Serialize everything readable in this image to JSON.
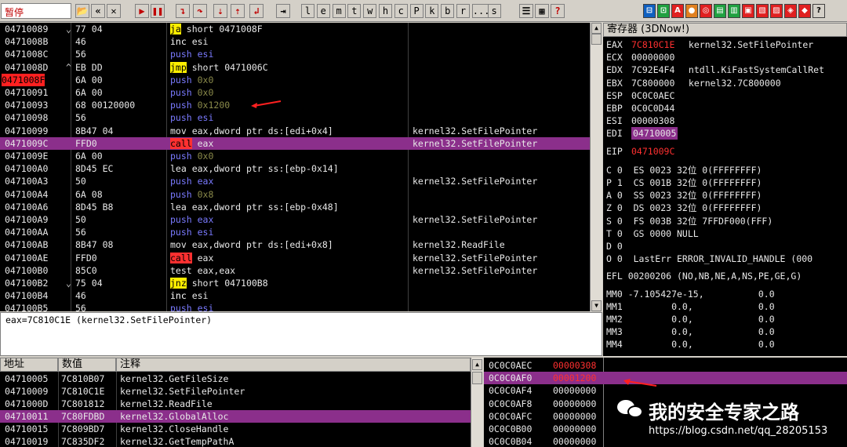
{
  "toolbar": {
    "status": "暂停",
    "letters": [
      "l",
      "e",
      "m",
      "t",
      "w",
      "h",
      "c",
      "P",
      "k",
      "b",
      "r",
      "...",
      "s"
    ]
  },
  "disasm": [
    {
      "a": "04710089",
      "caret": "⌄",
      "h": "77 04",
      "op": "ja",
      "ok": "jcc",
      "arg": " short 0471008F",
      "c": ""
    },
    {
      "a": "0471008B",
      "caret": "",
      "h": "46",
      "op": "inc",
      "ok": "inc",
      "arg": " esi",
      "c": ""
    },
    {
      "a": "0471008C",
      "caret": "",
      "h": "56",
      "op": "push",
      "ok": "push",
      "arg": " esi",
      "c": ""
    },
    {
      "a": "0471008D",
      "caret": "^",
      "h": "EB DD",
      "op": "jmp",
      "ok": "jmp",
      "arg": " short 0471006C",
      "c": ""
    },
    {
      "a": "0471008F",
      "caret": "",
      "h": "6A 00",
      "op": "push",
      "ok": "push",
      "arg": " 0x0",
      "c": "",
      "red": true
    },
    {
      "a": "04710091",
      "caret": "",
      "h": "6A 00",
      "op": "push",
      "ok": "push",
      "arg": " 0x0",
      "c": ""
    },
    {
      "a": "04710093",
      "caret": "",
      "h": "68 00120000",
      "op": "push",
      "ok": "push",
      "arg": " 0x1200",
      "c": ""
    },
    {
      "a": "04710098",
      "caret": "",
      "h": "56",
      "op": "push",
      "ok": "push",
      "arg": " esi",
      "c": ""
    },
    {
      "a": "04710099",
      "caret": "",
      "h": "8B47 04",
      "op": "mov",
      "ok": "mov",
      "arg": " eax,dword ptr ds:[edi+0x4]",
      "c": "kernel32.SetFilePointer"
    },
    {
      "a": "0471009C",
      "caret": "",
      "h": "FFD0",
      "op": "call",
      "ok": "call",
      "arg": " eax",
      "c": "kernel32.SetFilePointer",
      "sel": true
    },
    {
      "a": "0471009E",
      "caret": "",
      "h": "6A 00",
      "op": "push",
      "ok": "push",
      "arg": " 0x0",
      "c": ""
    },
    {
      "a": "047100A0",
      "caret": "",
      "h": "8D45 EC",
      "op": "lea",
      "ok": "mov",
      "arg": " eax,dword ptr ss:[ebp-0x14]",
      "c": ""
    },
    {
      "a": "047100A3",
      "caret": "",
      "h": "50",
      "op": "push",
      "ok": "push",
      "arg": " eax",
      "c": "kernel32.SetFilePointer"
    },
    {
      "a": "047100A4",
      "caret": "",
      "h": "6A 08",
      "op": "push",
      "ok": "push",
      "arg": " 0x8",
      "c": ""
    },
    {
      "a": "047100A6",
      "caret": "",
      "h": "8D45 B8",
      "op": "lea",
      "ok": "mov",
      "arg": " eax,dword ptr ss:[ebp-0x48]",
      "c": ""
    },
    {
      "a": "047100A9",
      "caret": "",
      "h": "50",
      "op": "push",
      "ok": "push",
      "arg": " eax",
      "c": "kernel32.SetFilePointer"
    },
    {
      "a": "047100AA",
      "caret": "",
      "h": "56",
      "op": "push",
      "ok": "push",
      "arg": " esi",
      "c": ""
    },
    {
      "a": "047100AB",
      "caret": "",
      "h": "8B47 08",
      "op": "mov",
      "ok": "mov",
      "arg": " eax,dword ptr ds:[edi+0x8]",
      "c": "kernel32.ReadFile"
    },
    {
      "a": "047100AE",
      "caret": "",
      "h": "FFD0",
      "op": "call",
      "ok": "call",
      "arg": " eax",
      "c": "kernel32.SetFilePointer"
    },
    {
      "a": "047100B0",
      "caret": "",
      "h": "85C0",
      "op": "test",
      "ok": "mov",
      "arg": " eax,eax",
      "c": "kernel32.SetFilePointer"
    },
    {
      "a": "047100B2",
      "caret": "⌄",
      "h": "75 04",
      "op": "jnz",
      "ok": "jcc",
      "arg": " short 047100B8",
      "c": ""
    },
    {
      "a": "047100B4",
      "caret": "",
      "h": "46",
      "op": "inc",
      "ok": "inc",
      "arg": " esi",
      "c": ""
    },
    {
      "a": "047100B5",
      "caret": "",
      "h": "56",
      "op": "push",
      "ok": "push",
      "arg": " esi",
      "c": ""
    }
  ],
  "info": "eax=7C810C1E (kernel32.SetFilePointer)",
  "regs": {
    "title": "寄存器 (3DNow!)",
    "lines": [
      {
        "n": "EAX",
        "v": "7C810C1E",
        "t": " kernel32.SetFilePointer",
        "vc": "#ff3030"
      },
      {
        "n": "ECX",
        "v": "00000000",
        "t": "",
        "vc": "#e8e8e8"
      },
      {
        "n": "EDX",
        "v": "7C92E4F4",
        "t": " ntdll.KiFastSystemCallRet",
        "vc": "#e8e8e8"
      },
      {
        "n": "EBX",
        "v": "7C800000",
        "t": " kernel32.7C800000",
        "vc": "#e8e8e8"
      },
      {
        "n": "ESP",
        "v": "0C0C0AEC",
        "t": "",
        "vc": "#e8e8e8"
      },
      {
        "n": "EBP",
        "v": "0C0C0D44",
        "t": "",
        "vc": "#e8e8e8"
      },
      {
        "n": "ESI",
        "v": "00000308",
        "t": "",
        "vc": "#e8e8e8"
      },
      {
        "n": "EDI",
        "v": "04710005",
        "t": "",
        "vc": "#e8e8e8",
        "box": true
      }
    ],
    "eip": {
      "n": "EIP",
      "v": "0471009C"
    },
    "flags": [
      "C 0  ES 0023 32位 0(FFFFFFFF)",
      "P 1  CS 001B 32位 0(FFFFFFFF)",
      "A 0  SS 0023 32位 0(FFFFFFFF)",
      "Z 0  DS 0023 32位 0(FFFFFFFF)",
      "S 0  FS 003B 32位 7FFDF000(FFF)",
      "T 0  GS 0000 NULL",
      "D 0",
      "O 0  LastErr ERROR_INVALID_HANDLE (000"
    ],
    "efl": "EFL 00200206 (NO,NB,NE,A,NS,PE,GE,G)",
    "mm": [
      "MM0 -7.105427e-15,          0.0",
      "MM1         0.0,            0.0",
      "MM2         0.0,            0.0",
      "MM3         0.0,            0.0",
      "MM4         0.0,            0.0"
    ]
  },
  "dump": {
    "headers": [
      "地址",
      "数值",
      "注释"
    ],
    "rows": [
      {
        "a": "04710005",
        "v": "7C810B07",
        "c": "kernel32.GetFileSize"
      },
      {
        "a": "04710009",
        "v": "7C810C1E",
        "c": "kernel32.SetFilePointer"
      },
      {
        "a": "0471000D",
        "v": "7C801812",
        "c": "kernel32.ReadFile"
      },
      {
        "a": "04710011",
        "v": "7C80FDBD",
        "c": "kernel32.GlobalAlloc",
        "sel": true
      },
      {
        "a": "04710015",
        "v": "7C809BD7",
        "c": "kernel32.CloseHandle"
      },
      {
        "a": "04710019",
        "v": "7C835DF2",
        "c": "kernel32.GetTempPathA"
      }
    ]
  },
  "stack": [
    {
      "a": "0C0C0AEC",
      "v": "00000308",
      "vc": "#ff3030"
    },
    {
      "a": "0C0C0AF0",
      "v": "00001200",
      "vc": "#ff3030",
      "sel": true
    },
    {
      "a": "0C0C0AF4",
      "v": "00000000",
      "vc": "#e8e8e8"
    },
    {
      "a": "0C0C0AF8",
      "v": "00000000",
      "vc": "#e8e8e8"
    },
    {
      "a": "0C0C0AFC",
      "v": "00000000",
      "vc": "#e8e8e8"
    },
    {
      "a": "0C0C0B00",
      "v": "00000000",
      "vc": "#e8e8e8"
    },
    {
      "a": "0C0C0B04",
      "v": "00000000",
      "vc": "#e8e8e8"
    }
  ],
  "watermark": {
    "title": "我的安全专家之路",
    "url": "https://blog.csdn.net/qq_28205153"
  }
}
